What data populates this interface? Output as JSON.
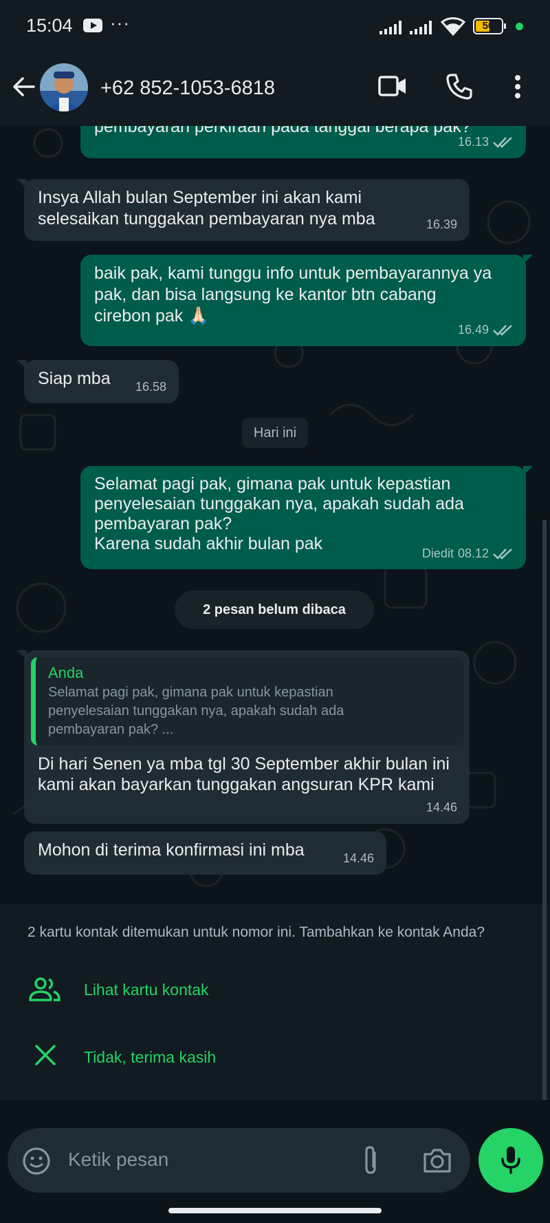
{
  "status_bar": {
    "time": "15:04",
    "battery": "50"
  },
  "header": {
    "contact": "+62 852-1053-6818"
  },
  "messages": [
    {
      "type": "out",
      "text": "pembayaran perkiraan pada tanggal berapa pak?",
      "time": "16.13"
    },
    {
      "type": "in",
      "text": "Insya Allah bulan September ini akan kami selesaikan tunggakan pembayaran nya mba",
      "time": "16.39"
    },
    {
      "type": "out",
      "text": "baik pak, kami tunggu info untuk pembayarannya ya pak, dan bisa langsung ke kantor btn cabang cirebon pak 🙏🏻",
      "time": "16.49"
    },
    {
      "type": "in",
      "text": "Siap mba",
      "time": "16.58"
    },
    {
      "type": "out",
      "text": "Selamat pagi pak, gimana pak untuk kepastian penyelesaian tunggakan nya, apakah sudah ada pembayaran pak?\nKarena sudah akhir bulan pak",
      "edited": "Diedit",
      "time": "08.12"
    },
    {
      "type": "in",
      "quote_name": "Anda",
      "quote_text": "Selamat pagi pak, gimana pak untuk kepastian penyelesaian tunggakan nya, apakah sudah ada pembayaran pak? ...",
      "text": "Di hari Senen ya mba tgl 30 September akhir bulan ini kami akan bayarkan tunggakan angsuran KPR kami",
      "time": "14.46"
    },
    {
      "type": "in",
      "text": "Mohon di terima konfirmasi ini mba",
      "time": "14.46"
    }
  ],
  "day_separator": "Hari ini",
  "unread_banner": "2 pesan belum dibaca",
  "contact_sheet": {
    "message": "2 kartu kontak ditemukan untuk nomor ini. Tambahkan ke kontak Anda?",
    "view_label": "Lihat kartu kontak",
    "dismiss_label": "Tidak, terima kasih"
  },
  "composer": {
    "placeholder": "Ketik pesan"
  },
  "colors": {
    "accent": "#25d366",
    "outgoing": "#005c4b",
    "incoming": "#202c33",
    "background": "#0b141a"
  }
}
